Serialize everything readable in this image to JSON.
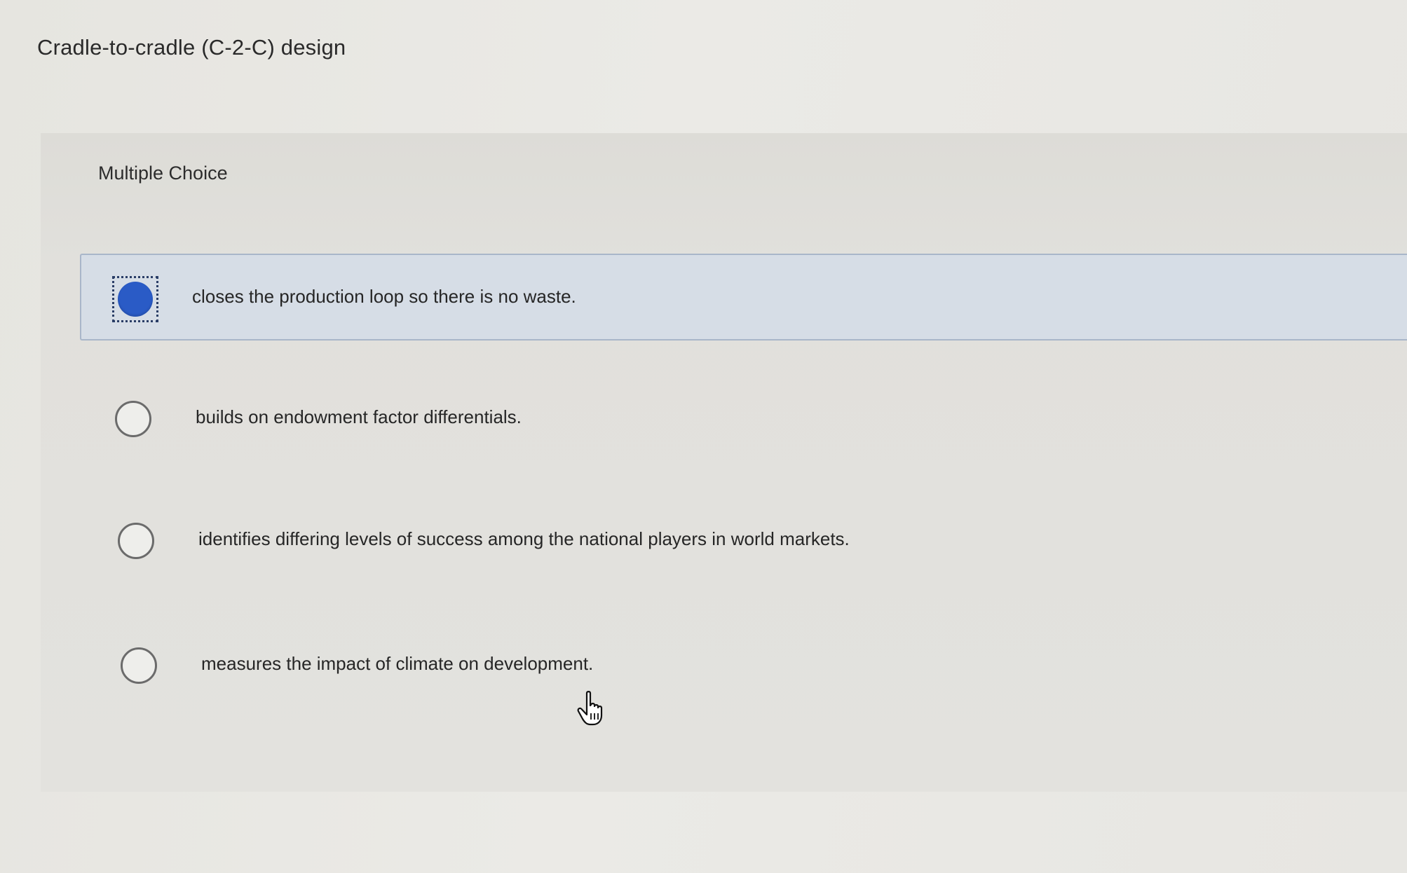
{
  "question": {
    "title": "Cradle-to-cradle (C-2-C) design",
    "type_label": "Multiple Choice"
  },
  "options": [
    {
      "label": "closes the production loop so there is no waste.",
      "selected": true
    },
    {
      "label": "builds on endowment factor differentials.",
      "selected": false
    },
    {
      "label": "identifies differing levels of success among the national players in world markets.",
      "selected": false
    },
    {
      "label": "measures the impact of climate on development.",
      "selected": false
    }
  ],
  "colors": {
    "selected_radio": "#2a5bc6",
    "selected_background": "#d6dde6",
    "selected_border": "#a9b6c9"
  },
  "cursor": {
    "icon": "hand-pointer-icon"
  }
}
